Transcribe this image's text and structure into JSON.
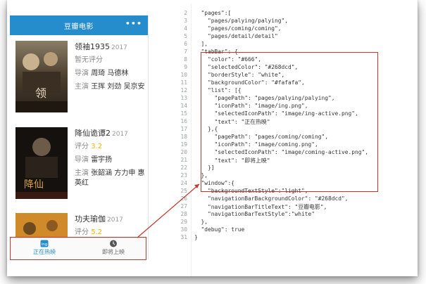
{
  "navbar": {
    "title": "豆瓣电影",
    "menu": "•••"
  },
  "movies": [
    {
      "title": "领袖1935",
      "year": "2017",
      "score_line": "暂无评分",
      "director_label": "导演",
      "director": "周琦 马德林",
      "cast_label": "主演",
      "cast": "王挥 刘劲 吴京安"
    },
    {
      "title": "降仙诡谭2",
      "year": "2017",
      "score_label": "评分",
      "score": "3.2",
      "director_label": "导演",
      "director": "雷宇扬",
      "cast_label": "主演",
      "cast": "张韶涵 方力申 惠英红"
    },
    {
      "title": "功夫瑜伽",
      "year": "2017",
      "score_label": "评分",
      "score": "5.2"
    }
  ],
  "tabbar": {
    "tabs": [
      {
        "label": "正在热映",
        "icon": "image-ing"
      },
      {
        "label": "即将上映",
        "icon": "image-coming"
      }
    ]
  },
  "code_lines": [
    {
      "n": "2",
      "t": "  \"pages\":["
    },
    {
      "n": "3",
      "t": "    \"pages/palying/palying\","
    },
    {
      "n": "4",
      "t": "    \"pages/coming/coming\","
    },
    {
      "n": "5",
      "t": "    \"pages/detail/detail\""
    },
    {
      "n": "6",
      "t": "  ],"
    },
    {
      "n": "7",
      "t": "  \"tabBar\": {"
    },
    {
      "n": "8",
      "t": "    \"color\": \"#666\","
    },
    {
      "n": "9",
      "t": "    \"selectedColor\": \"#268dcd\","
    },
    {
      "n": "10",
      "t": "    \"borderStyle\": \"white\","
    },
    {
      "n": "11",
      "t": "    \"backgroundColor\": \"#fafafa\","
    },
    {
      "n": "12",
      "t": "    \"list\": [{"
    },
    {
      "n": "13",
      "t": "      \"pagePath\": \"pages/palying/palying\","
    },
    {
      "n": "14",
      "t": "      \"iconPath\": \"image/ing.png\","
    },
    {
      "n": "15",
      "t": "      \"selectedIconPath\": \"image/ing-active.png\","
    },
    {
      "n": "16",
      "t": "      \"text\": \"正在热映\""
    },
    {
      "n": "17",
      "t": "    },{"
    },
    {
      "n": "18",
      "t": "      \"pagePath\": \"pages/coming/coming\","
    },
    {
      "n": "19",
      "t": "      \"iconPath\": \"image/coming.png\","
    },
    {
      "n": "20",
      "t": "      \"selectedIconPath\": \"image/coming-active.png\","
    },
    {
      "n": "21",
      "t": "      \"text\": \"即将上映\""
    },
    {
      "n": "22",
      "t": "    }]"
    },
    {
      "n": "23",
      "t": "  },"
    },
    {
      "n": "24",
      "t": "  \"window\":{"
    },
    {
      "n": "25",
      "t": "    \"backgroundTextStyle\":\"light\","
    },
    {
      "n": "26",
      "t": "    \"navigationBarBackgroundColor\": \"#268dcd\","
    },
    {
      "n": "27",
      "t": "    \"navigationBarTitleText\": \"豆瓣电影\","
    },
    {
      "n": "28",
      "t": "    \"navigationBarTextStyle\":\"white\""
    },
    {
      "n": "29",
      "t": "  },"
    },
    {
      "n": "30",
      "t": "  \"debug\": true"
    },
    {
      "n": "31",
      "t": "}"
    }
  ],
  "colors": {
    "accent": "#268dcd",
    "highlight": "#c0392b",
    "score": "#f4b400"
  }
}
